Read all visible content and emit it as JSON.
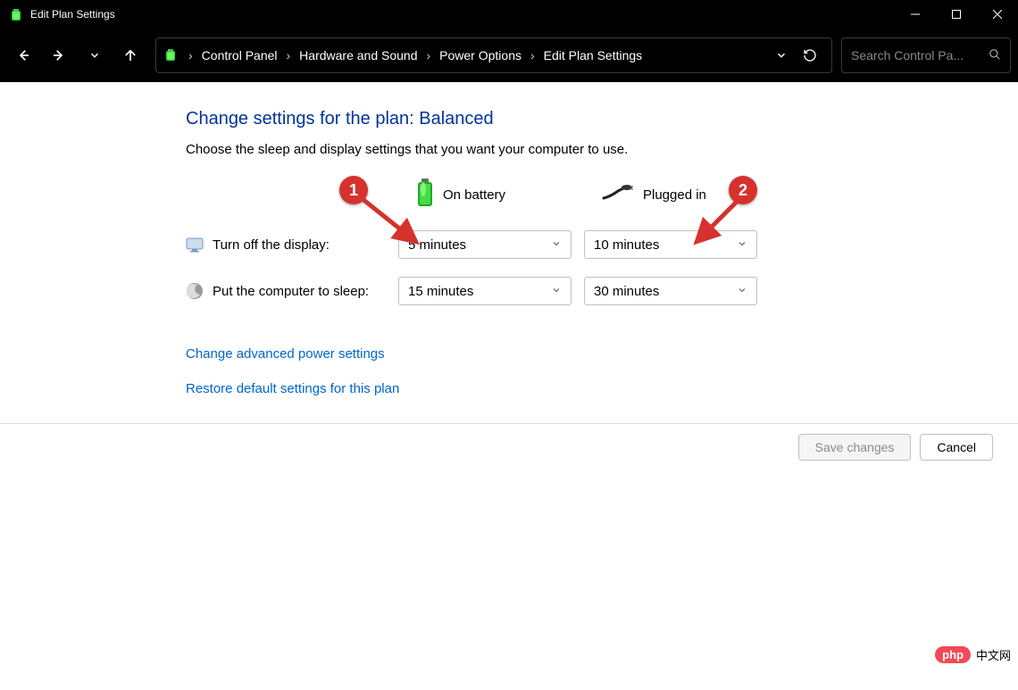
{
  "window": {
    "title": "Edit Plan Settings"
  },
  "breadcrumb": {
    "items": [
      "Control Panel",
      "Hardware and Sound",
      "Power Options",
      "Edit Plan Settings"
    ]
  },
  "search": {
    "placeholder": "Search Control Pa..."
  },
  "page": {
    "title": "Change settings for the plan: Balanced",
    "subtitle": "Choose the sleep and display settings that you want your computer to use."
  },
  "columns": {
    "battery": "On battery",
    "plugged": "Plugged in"
  },
  "rows": {
    "display": {
      "label": "Turn off the display:",
      "battery": "5 minutes",
      "plugged": "10 minutes"
    },
    "sleep": {
      "label": "Put the computer to sleep:",
      "battery": "15 minutes",
      "plugged": "30 minutes"
    }
  },
  "links": {
    "advanced": "Change advanced power settings",
    "restore": "Restore default settings for this plan"
  },
  "buttons": {
    "save": "Save changes",
    "cancel": "Cancel"
  },
  "annotations": {
    "one": "1",
    "two": "2"
  },
  "watermark": {
    "brand": "php",
    "text": "中文网"
  }
}
